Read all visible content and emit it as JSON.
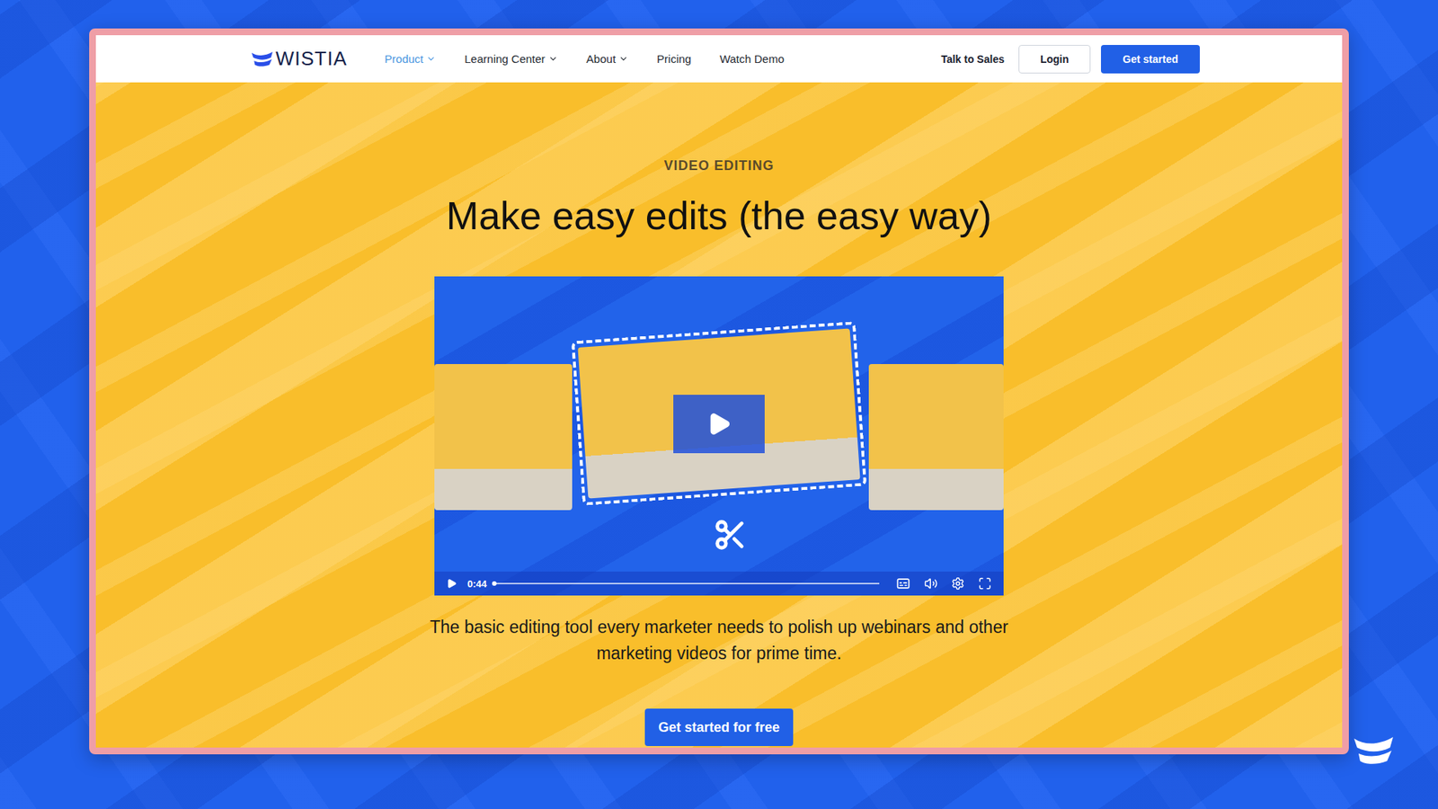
{
  "logo": "WISTIA",
  "nav": {
    "links": [
      {
        "label": "Product",
        "selected": true,
        "dropdown": true
      },
      {
        "label": "Learning Center",
        "selected": false,
        "dropdown": true
      },
      {
        "label": "About",
        "selected": false,
        "dropdown": true
      },
      {
        "label": "Pricing",
        "selected": false,
        "dropdown": false
      },
      {
        "label": "Watch Demo",
        "selected": false,
        "dropdown": false
      }
    ],
    "actions": [
      {
        "label": "Talk to Sales",
        "kind": "link"
      },
      {
        "label": "Login",
        "kind": "outline"
      },
      {
        "label": "Get started",
        "kind": "primary"
      }
    ]
  },
  "hero": {
    "eyebrow": "VIDEO EDITING",
    "title": "Make easy edits (the easy way)",
    "subtitle": "The basic editing tool every marketer needs to polish up webinars and other marketing videos for prime time.",
    "cta": "Get started for free"
  },
  "video": {
    "time": "0:44",
    "level": 0,
    "playing": false
  }
}
